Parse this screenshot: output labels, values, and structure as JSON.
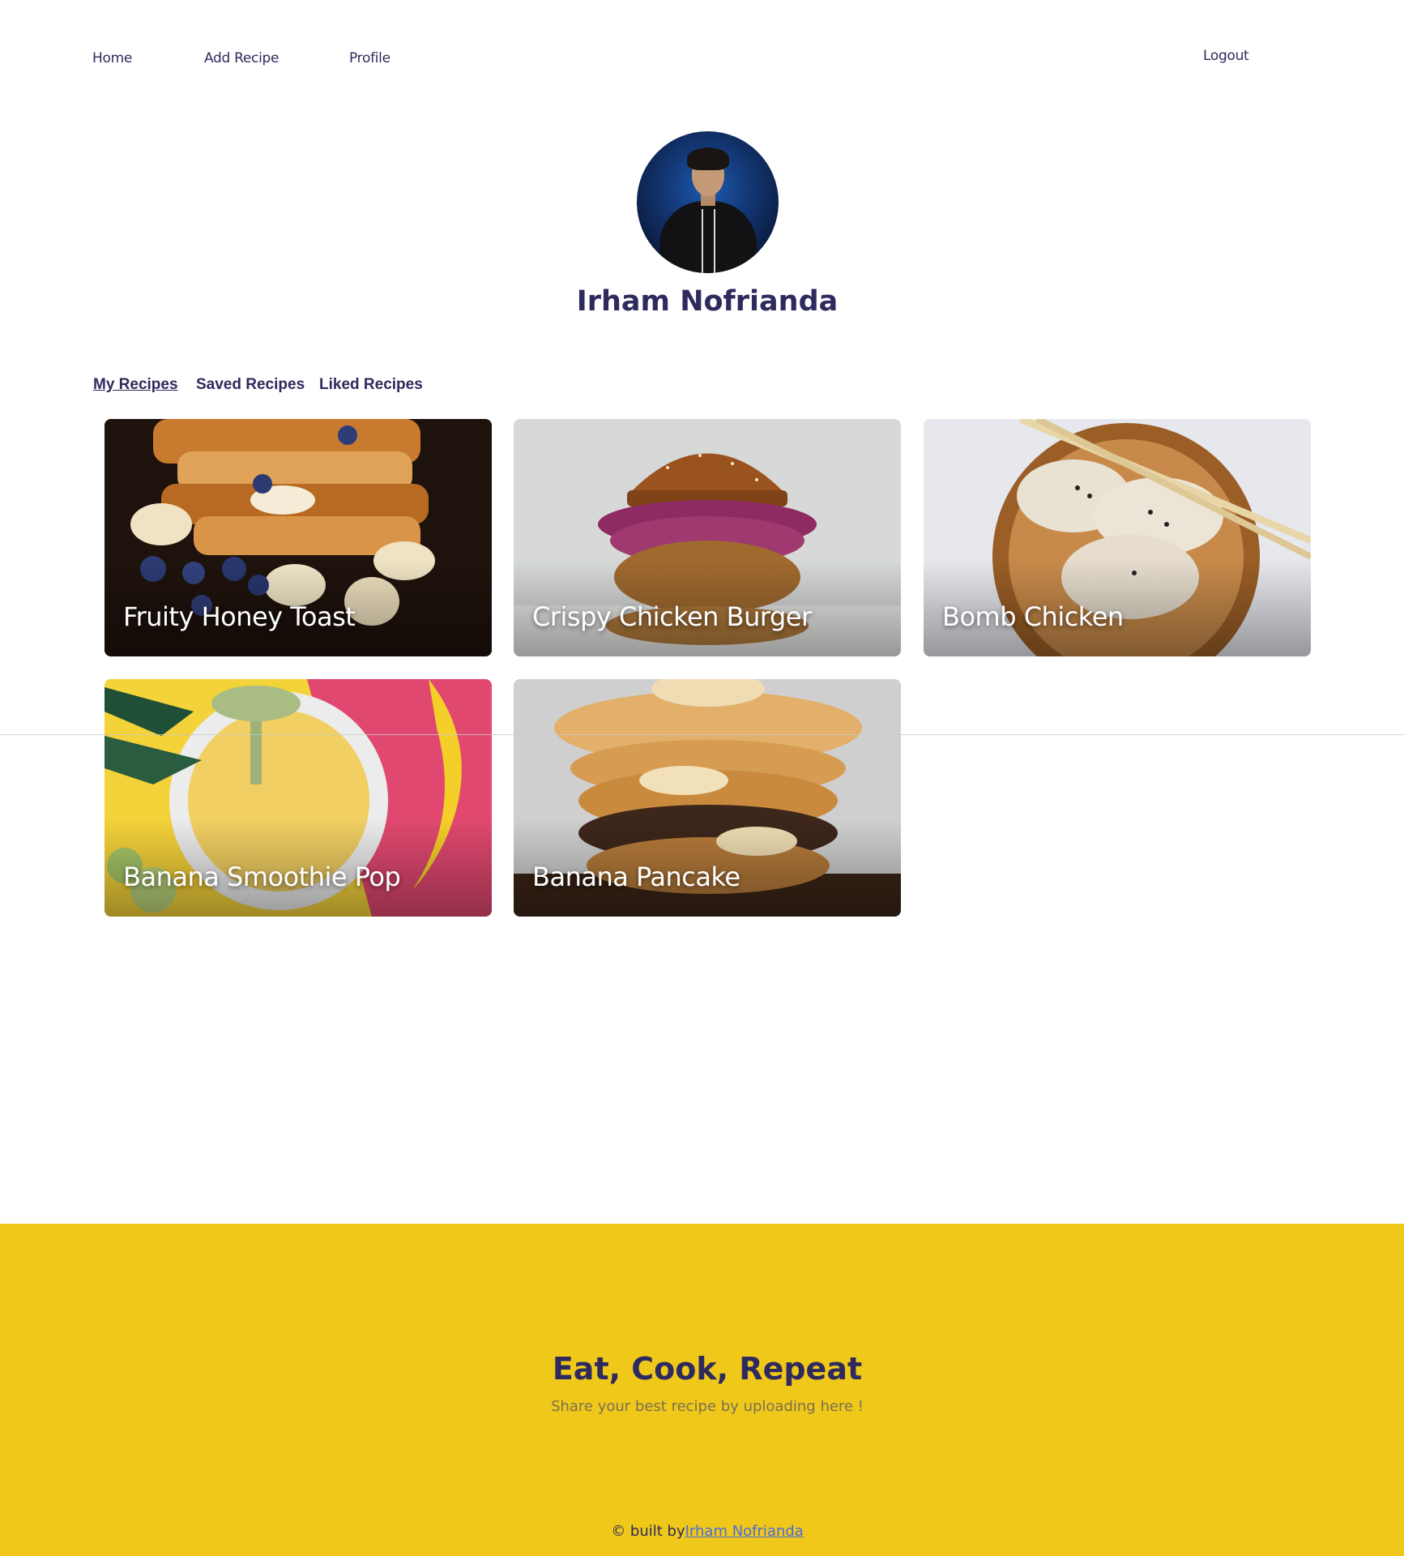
{
  "nav": {
    "home": "Home",
    "add_recipe": "Add Recipe",
    "profile": "Profile",
    "logout": "Logout"
  },
  "profile": {
    "name": "Irham Nofrianda"
  },
  "tabs": [
    {
      "label": "My Recipes",
      "active": true
    },
    {
      "label": "Saved Recipes",
      "active": false
    },
    {
      "label": "Liked Recipes",
      "active": false
    }
  ],
  "recipes": [
    {
      "title": "Fruity Honey Toast"
    },
    {
      "title": "Crispy Chicken Burger"
    },
    {
      "title": "Bomb Chicken"
    },
    {
      "title": "Banana Smoothie Pop"
    },
    {
      "title": "Banana Pancake"
    }
  ],
  "footer": {
    "headline": "Eat, Cook, Repeat",
    "subline": "Share your best recipe by uploading here !",
    "credit_prefix": "© built by",
    "credit_link": "Irham Nofrianda"
  },
  "colors": {
    "primary_text": "#2e2a5e",
    "footer_bg": "#efc81a",
    "link": "#4a6ae0"
  }
}
